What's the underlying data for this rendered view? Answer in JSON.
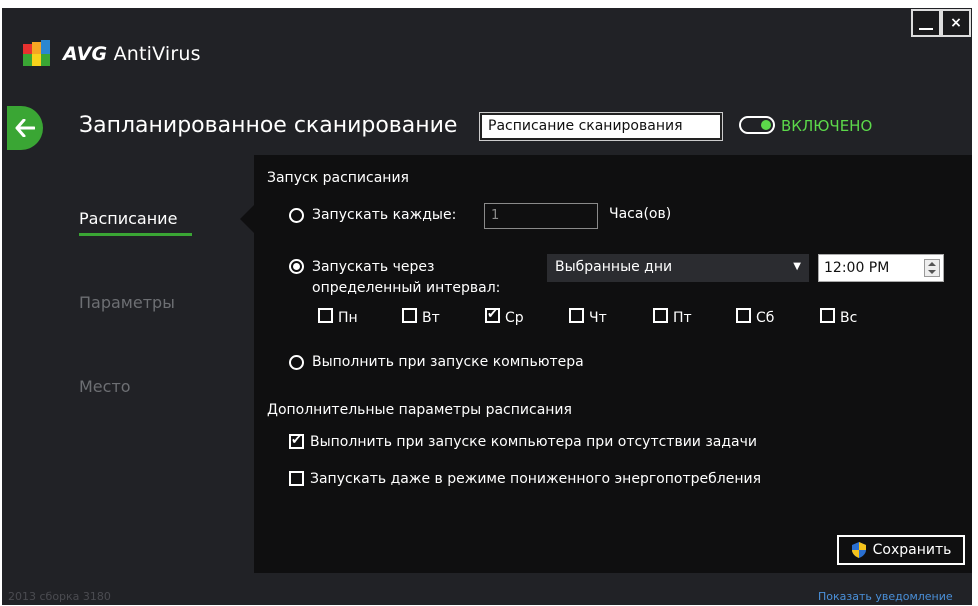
{
  "app": {
    "logo_brand": "AVG",
    "logo_product": "AntiVirus",
    "minimize_label": "",
    "close_label": "×"
  },
  "header": {
    "title": "Запланированное сканирование",
    "name_value": "Расписание сканирования",
    "toggle_label": "ВКЛЮЧЕНО"
  },
  "nav": {
    "items": [
      {
        "label": "Расписание",
        "active": true
      },
      {
        "label": "Параметры",
        "active": false
      },
      {
        "label": "Место",
        "active": false
      }
    ]
  },
  "schedule": {
    "section_title": "Запуск расписания",
    "every_label": "Запускать каждые:",
    "every_value": "1",
    "every_unit": "Часа(ов)",
    "interval_label_1": "Запускать через",
    "interval_label_2": "определенный интервал:",
    "interval_select": "Выбранные дни",
    "interval_time": "12:00 PM",
    "days": [
      {
        "label": "Пн",
        "checked": false
      },
      {
        "label": "Вт",
        "checked": false
      },
      {
        "label": "Ср",
        "checked": true
      },
      {
        "label": "Чт",
        "checked": false
      },
      {
        "label": "Пт",
        "checked": false
      },
      {
        "label": "Сб",
        "checked": false
      },
      {
        "label": "Вс",
        "checked": false
      }
    ],
    "on_startup_label": "Выполнить при запуске компьютера",
    "selected_option": "interval"
  },
  "advanced": {
    "section_title": "Дополнительные параметры расписания",
    "missed_label": "Выполнить при запуске компьютера при отсутствии задачи",
    "missed_checked": true,
    "lowpower_label": "Запускать даже в режиме пониженного энергопотребления",
    "lowpower_checked": false
  },
  "actions": {
    "save_label": "Сохранить"
  },
  "footer": {
    "build": "2013  сборка 3180",
    "notify_link": "Показать уведомление"
  },
  "colors": {
    "accent": "#3aa634",
    "toggle_on": "#5cd84a",
    "background": "#212226",
    "panel": "#0f0f10",
    "link": "#4a90d9"
  }
}
